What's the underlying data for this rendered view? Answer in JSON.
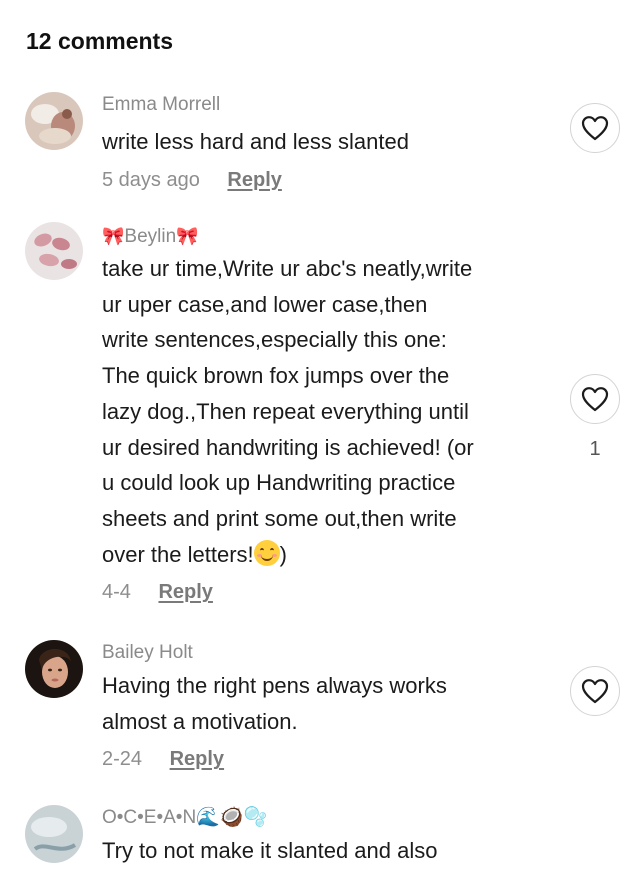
{
  "header": {
    "title": "12 comments"
  },
  "comments": [
    {
      "author": "Emma Morrell",
      "text": "write less hard and less slanted",
      "date": "5 days ago",
      "reply_label": "Reply",
      "likes": ""
    },
    {
      "author_prefix": "🎀",
      "author": "Beylin",
      "author_suffix": "🎀",
      "text_lines": [
        "take ur time,Write ur abc's neatly,write",
        "ur uper case,and lower case,then",
        "write sentences,especially this one:",
        "The quick brown fox jumps over the",
        "lazy dog.,Then repeat everything until",
        "ur desired handwriting is achieved! (or",
        "u could look up Handwriting practice",
        "sheets and print some out,then write",
        "over the letters!"
      ],
      "text_end": ")",
      "emoji": "smiling-face-with-smiling-eyes",
      "date": "4-4",
      "reply_label": "Reply",
      "likes": "1"
    },
    {
      "author": "Bailey Holt",
      "text_lines": [
        "Having the right pens always works",
        "almost a motivation."
      ],
      "date": "2-24",
      "reply_label": "Reply",
      "likes": ""
    },
    {
      "author": "O•C•E•A•N",
      "author_suffix": "🌊🥥🫧",
      "text": "Try to not make it slanted and also"
    }
  ],
  "icons": {
    "like": "heart-outline-icon"
  },
  "colors": {
    "meta": "#8e8e8e",
    "text": "#1b1b1b",
    "bow": "#e25a86"
  }
}
